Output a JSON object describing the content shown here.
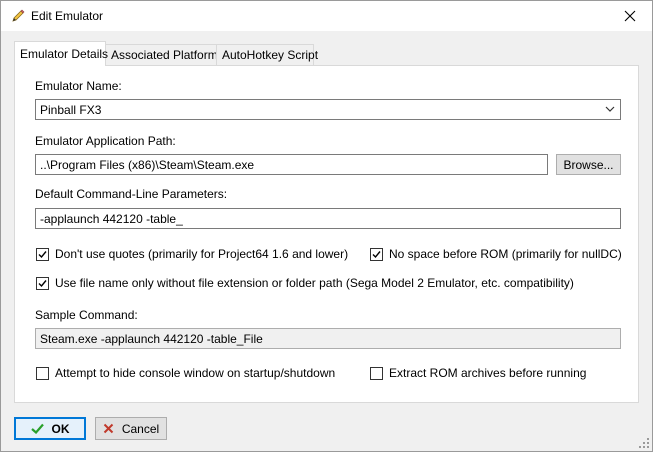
{
  "window": {
    "title": "Edit Emulator",
    "icon": "pencil-icon",
    "close_icon": "close-icon"
  },
  "tabs": [
    {
      "label": "Emulator Details",
      "active": true
    },
    {
      "label": "Associated Platforms",
      "active": false
    },
    {
      "label": "AutoHotkey Script",
      "active": false
    }
  ],
  "form": {
    "emulator_name_label": "Emulator Name:",
    "emulator_name_value": "Pinball FX3",
    "app_path_label": "Emulator Application Path:",
    "app_path_value": "..\\Program Files (x86)\\Steam\\Steam.exe",
    "browse_label": "Browse...",
    "cmd_params_label": "Default Command-Line Parameters:",
    "cmd_params_value": "-applaunch 442120 -table_",
    "sample_command_label": "Sample Command:",
    "sample_command_value": "Steam.exe -applaunch 442120 -table_File"
  },
  "options": {
    "dont_use_quotes": {
      "label": "Don't use quotes (primarily for Project64 1.6 and lower)",
      "checked": true
    },
    "no_space_before_rom": {
      "label": "No space before ROM (primarily for nullDC)",
      "checked": true
    },
    "file_name_only": {
      "label": "Use file name only without file extension or folder path (Sega Model 2 Emulator, etc. compatibility)",
      "checked": true
    },
    "hide_console": {
      "label": "Attempt to hide console window on startup/shutdown",
      "checked": false
    },
    "extract_rom": {
      "label": "Extract ROM archives before running",
      "checked": false
    }
  },
  "buttons": {
    "ok_label": "OK",
    "cancel_label": "Cancel"
  },
  "colors": {
    "accent": "#0078d7",
    "ok_check": "#2aa02a",
    "cancel_x": "#c0392b"
  }
}
